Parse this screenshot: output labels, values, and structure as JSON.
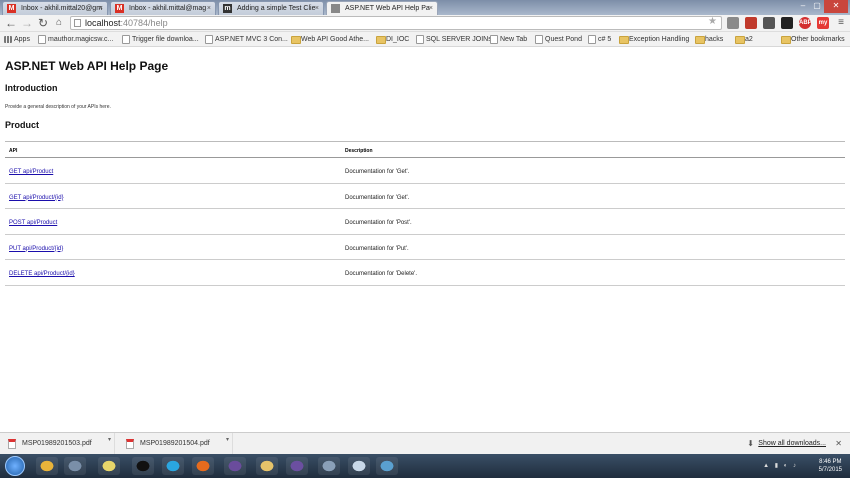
{
  "browser": {
    "tabs": [
      {
        "title": "Inbox - akhil.mittal20@gm",
        "icon": "gmail-icon",
        "color": "#d93025",
        "glyph": "M"
      },
      {
        "title": "Inbox - akhil.mittal@mag",
        "icon": "gmail-icon",
        "color": "#d93025",
        "glyph": "M"
      },
      {
        "title": "Adding a simple Test Clie",
        "icon": "m-site-icon",
        "color": "#333333",
        "glyph": "m"
      },
      {
        "title": "ASP.NET Web API Help Pa",
        "icon": "page-icon",
        "color": "#888888",
        "glyph": ""
      }
    ],
    "url_host": "localhost",
    "url_rest": ":40784/help",
    "extensions": [
      {
        "name": "extension-1-icon",
        "color": "#8a8a8a",
        "glyph": ""
      },
      {
        "name": "extension-2-icon",
        "color": "#c0392b",
        "glyph": ""
      },
      {
        "name": "extension-3-icon",
        "color": "#555555",
        "glyph": ""
      },
      {
        "name": "extension-4-icon",
        "color": "#222222",
        "glyph": ""
      },
      {
        "name": "adblock-icon",
        "color": "#d32f2f",
        "glyph": "ABP"
      },
      {
        "name": "my-extension-icon",
        "color": "#e53935",
        "glyph": "my"
      }
    ],
    "bookmarks": [
      {
        "label": "Apps",
        "kind": "apps"
      },
      {
        "label": "mauthor.magicsw.c...",
        "kind": "page"
      },
      {
        "label": "Trigger file downloa...",
        "kind": "page"
      },
      {
        "label": "ASP.NET MVC 3 Con...",
        "kind": "page"
      },
      {
        "label": "Web API Good Athe...",
        "kind": "folder"
      },
      {
        "label": "DI_IOC",
        "kind": "folder"
      },
      {
        "label": "SQL SERVER JOINs",
        "kind": "page"
      },
      {
        "label": "New Tab",
        "kind": "page"
      },
      {
        "label": "Quest Pond",
        "kind": "page"
      },
      {
        "label": "c# 5",
        "kind": "page"
      },
      {
        "label": "Exception Handling",
        "kind": "folder"
      },
      {
        "label": "hacks",
        "kind": "folder"
      },
      {
        "label": "a2",
        "kind": "folder"
      },
      {
        "label": "Other bookmarks",
        "kind": "folder"
      }
    ]
  },
  "page": {
    "title": "ASP.NET Web API Help Page",
    "intro_heading": "Introduction",
    "intro_text": "Provide a general description of your APIs here.",
    "section_heading": "Product",
    "table": {
      "headers": [
        "API",
        "Description"
      ],
      "rows": [
        {
          "api": "GET api/Product",
          "description": "Documentation for 'Get'."
        },
        {
          "api": "GET api/Product/{id}",
          "description": "Documentation for 'Get'."
        },
        {
          "api": "POST api/Product",
          "description": "Documentation for 'Post'."
        },
        {
          "api": "PUT api/Product/{id}",
          "description": "Documentation for 'Put'."
        },
        {
          "api": "DELETE api/Product/{id}",
          "description": "Documentation for 'Delete'."
        }
      ]
    }
  },
  "downloads": {
    "items": [
      "MSP01989201503.pdf",
      "MSP01989201504.pdf"
    ],
    "show_all": "Show all downloads..."
  },
  "taskbar": {
    "time": "8:46 PM",
    "date": "5/7/2015",
    "apps": [
      {
        "name": "chrome-icon",
        "color": "#e8b33a"
      },
      {
        "name": "network-icon",
        "color": "#7a8fa8"
      },
      {
        "name": "sticky-notes-icon",
        "color": "#e8d66a"
      },
      {
        "name": "p-app-icon",
        "color": "#111111"
      },
      {
        "name": "skype-icon",
        "color": "#2aa6e0"
      },
      {
        "name": "firefox-icon",
        "color": "#e76b1d"
      },
      {
        "name": "media-icon",
        "color": "#6a4c9c"
      },
      {
        "name": "explorer-icon",
        "color": "#e6c36a"
      },
      {
        "name": "visual-studio-icon",
        "color": "#6b4fa0"
      },
      {
        "name": "tools-icon",
        "color": "#8aa0b8"
      },
      {
        "name": "paint-icon",
        "color": "#c8d8e8"
      },
      {
        "name": "app-icon",
        "color": "#5aa0d0"
      }
    ]
  }
}
